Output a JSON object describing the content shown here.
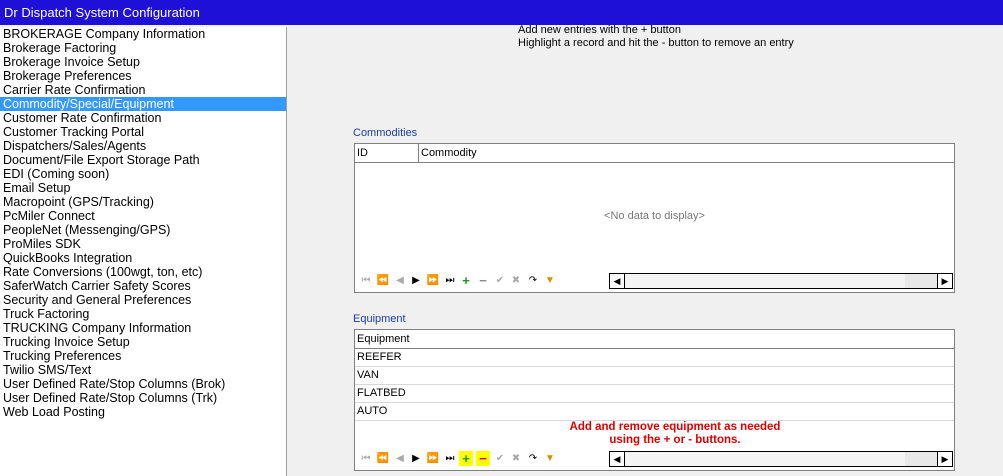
{
  "window": {
    "title": "Dr Dispatch  System Configuration"
  },
  "sidebar": {
    "items": [
      {
        "label": "BROKERAGE Company Information"
      },
      {
        "label": "Brokerage Factoring"
      },
      {
        "label": "Brokerage Invoice Setup"
      },
      {
        "label": "Brokerage Preferences"
      },
      {
        "label": "Carrier Rate Confirmation"
      },
      {
        "label": "Commodity/Special/Equipment",
        "selected": true
      },
      {
        "label": "Customer Rate Confirmation"
      },
      {
        "label": "Customer Tracking Portal"
      },
      {
        "label": "Dispatchers/Sales/Agents"
      },
      {
        "label": "Document/File Export Storage Path"
      },
      {
        "label": "EDI (Coming soon)"
      },
      {
        "label": "Email Setup"
      },
      {
        "label": "Macropoint (GPS/Tracking)"
      },
      {
        "label": "PcMiler Connect"
      },
      {
        "label": "PeopleNet (Messenging/GPS)"
      },
      {
        "label": "ProMiles SDK"
      },
      {
        "label": "QuickBooks Integration"
      },
      {
        "label": "Rate Conversions (100wgt, ton, etc)"
      },
      {
        "label": "SaferWatch Carrier Safety Scores"
      },
      {
        "label": "Security and General Preferences"
      },
      {
        "label": "Truck Factoring"
      },
      {
        "label": "TRUCKING Company Information"
      },
      {
        "label": "Trucking Invoice Setup"
      },
      {
        "label": "Trucking Preferences"
      },
      {
        "label": "Twilio SMS/Text"
      },
      {
        "label": "User Defined Rate/Stop Columns (Brok)"
      },
      {
        "label": "User Defined Rate/Stop Columns (Trk)"
      },
      {
        "label": "Web Load Posting"
      }
    ]
  },
  "main": {
    "instructions": {
      "line1": "Add new entries with the + button",
      "line2": "Highlight a record and hit the - button to remove an entry"
    },
    "commodities": {
      "label": "Commodities",
      "columns": [
        "ID",
        "Commodity"
      ],
      "empty_text": "<No data to display>"
    },
    "equipment": {
      "label": "Equipment",
      "column": "Equipment",
      "rows": [
        "REEFER",
        "VAN",
        "FLATBED",
        "AUTO"
      ],
      "annotation_line1": "Add and remove equipment as needed",
      "annotation_line2": "using the + or - buttons."
    }
  },
  "navigator": {
    "buttons": [
      {
        "name": "first-icon",
        "glyph": "⏮",
        "active": false
      },
      {
        "name": "prior-page-icon",
        "glyph": "⏪",
        "active": false
      },
      {
        "name": "prior-icon",
        "glyph": "◀",
        "active": false
      },
      {
        "name": "next-icon",
        "glyph": "▶",
        "active": true
      },
      {
        "name": "next-page-icon",
        "glyph": "⏩",
        "active": true
      },
      {
        "name": "last-icon",
        "glyph": "⏭",
        "active": true
      },
      {
        "name": "add-icon",
        "glyph": "+",
        "active": true
      },
      {
        "name": "remove-icon",
        "glyph": "−",
        "active": false
      },
      {
        "name": "post-icon",
        "glyph": "✔",
        "active": false
      },
      {
        "name": "cancel-icon",
        "glyph": "✖",
        "active": false
      },
      {
        "name": "refresh-icon",
        "glyph": "↷",
        "active": true
      },
      {
        "name": "filter-icon",
        "glyph": "▼",
        "active": true
      }
    ]
  },
  "colors": {
    "titlebar": "#1f10d8",
    "selection": "#3399ff",
    "section_label": "#1a3ea3",
    "annotation": "#e00000",
    "highlight": "#ffff00"
  }
}
